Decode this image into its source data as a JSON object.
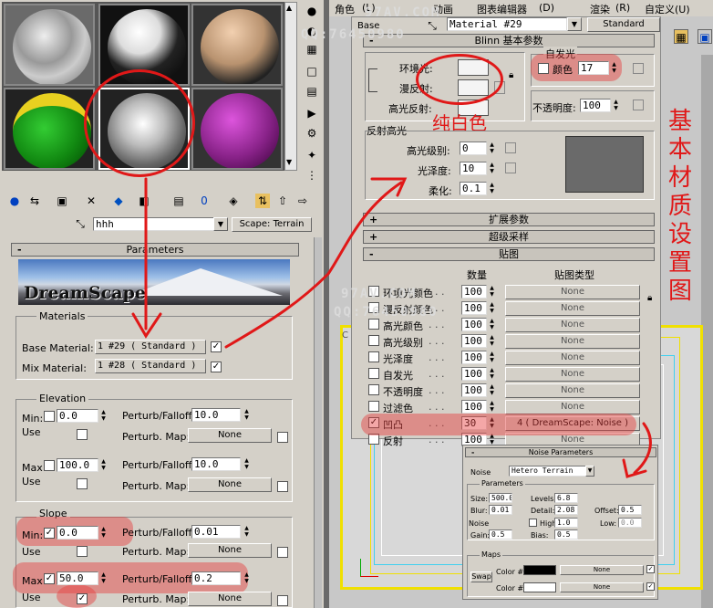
{
  "left": {
    "material_name": "hhh",
    "material_type": "Scape: Terrain",
    "parameters_title": "Parameters",
    "banner_text": "DreamScape",
    "materials_group": "Materials",
    "base_material_label": "Base Material:",
    "base_material_value": "1 #29   ( Standard )",
    "mix_material_label": "Mix Material:",
    "mix_material_value": "1 #28   ( Standard )",
    "elevation_group": "Elevation",
    "min_label": "Min:",
    "elev_min": "0.0",
    "max_label": "Max:",
    "elev_max": "100.0",
    "use_label": "Use",
    "perturb_falloff_label": "Perturb/Falloff:",
    "elev_min_pf": "10.0",
    "elev_max_pf": "10.0",
    "perturb_map_label": "Perturb. Map:",
    "none": "None",
    "slope_group": "Slope",
    "slope_min": "0.0",
    "slope_max": "50.0",
    "slope_min_pf": "0.01",
    "slope_max_pf": "0.2"
  },
  "right": {
    "menu_items": [
      "角色",
      "(L)",
      "动画",
      "图表编辑器",
      "(D)",
      "渲染",
      "(R)",
      "自定义(U)"
    ],
    "material_name": "Material #29",
    "material_type": "Standard",
    "tab_base": "Base",
    "blinn_title": "Blinn 基本参数",
    "ambient_label": "环境光:",
    "diffuse_label": "漫反射:",
    "specular_label": "高光反射:",
    "self_illum_group": "自发光",
    "color_label": "颜色",
    "self_illum_value": "17",
    "opacity_label": "不透明度:",
    "opacity_value": "100",
    "specular_group": "反射高光",
    "spec_level_label": "高光级别:",
    "spec_level_value": "0",
    "gloss_label": "光泽度:",
    "gloss_value": "10",
    "soften_label": "柔化:",
    "soften_value": "0.1",
    "rollout_extended": "扩展参数",
    "rollout_supersampling": "超级采样",
    "rollout_maps": "贴图",
    "maps_col_amount": "数量",
    "maps_col_type": "贴图类型",
    "maps": [
      {
        "name": "环境光颜色",
        "amount": "100",
        "type": "None",
        "checked": false
      },
      {
        "name": "漫反射颜色",
        "amount": "100",
        "type": "None",
        "checked": false
      },
      {
        "name": "高光颜色",
        "amount": "100",
        "type": "None",
        "checked": false
      },
      {
        "name": "高光级别",
        "amount": "100",
        "type": "None",
        "checked": false
      },
      {
        "name": "光泽度",
        "amount": "100",
        "type": "None",
        "checked": false
      },
      {
        "name": "自发光",
        "amount": "100",
        "type": "None",
        "checked": false
      },
      {
        "name": "不透明度",
        "amount": "100",
        "type": "None",
        "checked": false
      },
      {
        "name": "过滤色",
        "amount": "100",
        "type": "None",
        "checked": false
      },
      {
        "name": "凹凸",
        "amount": "30",
        "type": "4   ( DreamScape: Noise )",
        "checked": true
      },
      {
        "name": "反射",
        "amount": "100",
        "type": "None",
        "checked": false
      }
    ]
  },
  "noise": {
    "title": "Noise Parameters",
    "noise_label": "Noise",
    "noise_type": "Hetero Terrain",
    "params_group": "Parameters",
    "size_label": "Size:",
    "size": "500.0",
    "levels_label": "Levels:",
    "levels": "6.8",
    "blur_label": "Blur:",
    "blur": "0.01",
    "detail_label": "Detail:",
    "detail": "2.08",
    "offset_label": "Offset:",
    "offset": "0.5",
    "noise2_label": "Noise",
    "high_label": "High:",
    "high": "1.0",
    "low_label": "Low:",
    "low": "0.0",
    "gain_label": "Gain:",
    "gain": "0.5",
    "bias_label": "Bias:",
    "bias": "0.5",
    "maps_group": "Maps",
    "swap_label": "Swap",
    "color1_label": "Color #1",
    "color2_label": "Color #2",
    "none": "None"
  },
  "annotations": {
    "pure_white": "纯白色",
    "side_title": "基本材质设置图"
  },
  "watermarks": {
    "site": "97AV.COM",
    "qq": "QQ:76450980"
  },
  "colors": {
    "annotation_red": "#e01818",
    "highlight_red": "#e63c3c",
    "viewport_yellow": "#f0e000"
  }
}
